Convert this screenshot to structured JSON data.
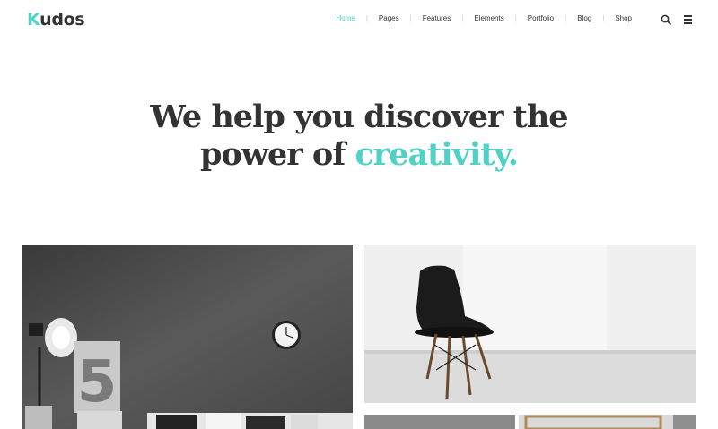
{
  "brand": {
    "logo_first": "K",
    "logo_rest": "udos"
  },
  "nav": {
    "items": [
      {
        "label": "Home",
        "active": true
      },
      {
        "label": "Pages"
      },
      {
        "label": "Features"
      },
      {
        "label": "Elements"
      },
      {
        "label": "Portfolio"
      },
      {
        "label": "Blog"
      },
      {
        "label": "Shop"
      }
    ],
    "separator": "|"
  },
  "icons": {
    "search": "search-icon",
    "menu": "hamburger-menu-icon"
  },
  "hero": {
    "line1": "We help you discover the",
    "line2_prefix": "power of ",
    "line2_accent": "creativity."
  },
  "colors": {
    "accent": "#4fd1c5",
    "text": "#333333",
    "background": "#ffffff"
  }
}
